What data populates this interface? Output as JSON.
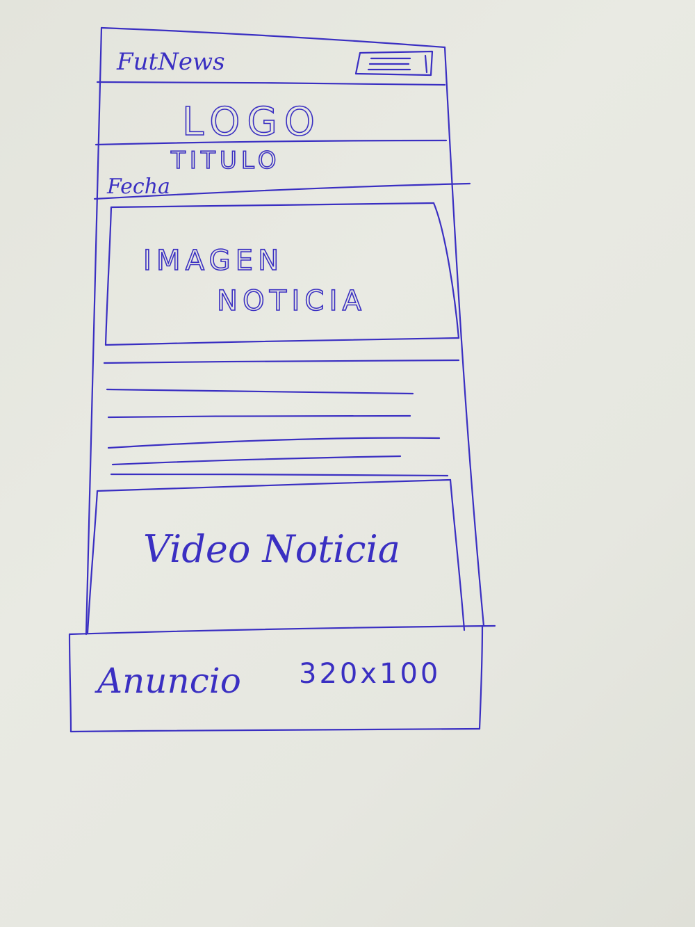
{
  "header": {
    "app_name": "FutNews",
    "menu_icon": "hamburger-menu-icon"
  },
  "logo": {
    "label": "LOGO"
  },
  "article": {
    "title": "TITULO",
    "date": "Fecha"
  },
  "image_box": {
    "line1": "IMAGEN",
    "line2": "NOTICIA"
  },
  "body_text": {
    "line_count": 6
  },
  "video_box": {
    "label": "Video Noticia"
  },
  "ad_banner": {
    "label": "Anuncio",
    "size": "320x100"
  },
  "colors": {
    "ink": "#3a2fc2",
    "paper": "#e6e7e0"
  }
}
